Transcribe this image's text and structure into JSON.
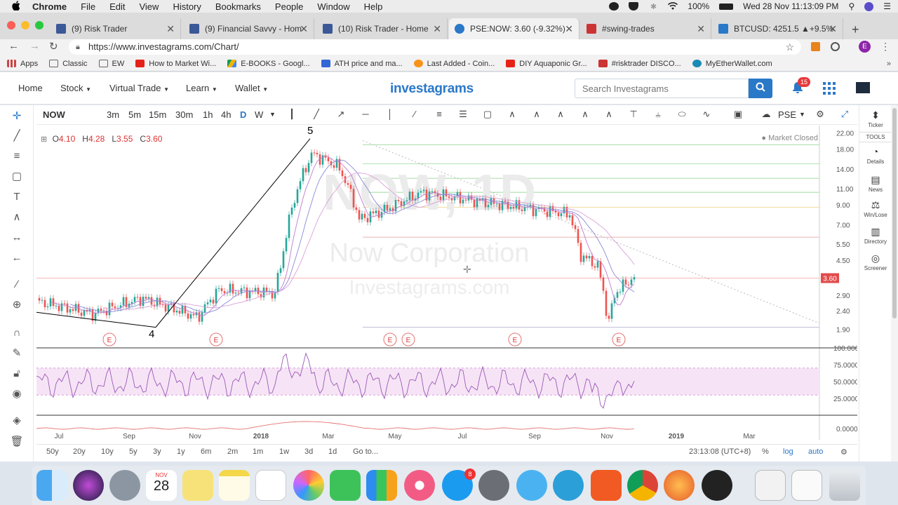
{
  "menubar": {
    "app": "Chrome",
    "items": [
      "File",
      "Edit",
      "View",
      "History",
      "Bookmarks",
      "People",
      "Window",
      "Help"
    ],
    "battery": "100%",
    "datetime": "Wed 28 Nov  11:13:09 PM"
  },
  "tabs": [
    {
      "title": "(9) Risk Trader",
      "color": "#3b5998"
    },
    {
      "title": "(9) Financial Savvy - Hom",
      "color": "#3b5998"
    },
    {
      "title": "(10) Risk Trader - Home",
      "color": "#3b5998"
    },
    {
      "title": "PSE:NOW: 3.60 (-9.32%)",
      "color": "#2a78c8"
    },
    {
      "title": "#swing-trades",
      "color": "#c33"
    },
    {
      "title": "BTCUSD: 4251.5 ▲+9.5%",
      "color": "#2a78c8"
    }
  ],
  "address": {
    "url": "https://www.investagrams.com/Chart/"
  },
  "bookmarks": [
    {
      "label": "Apps",
      "color": "#c44"
    },
    {
      "label": "Classic",
      "color": "#888"
    },
    {
      "label": "EW",
      "color": "#888"
    },
    {
      "label": "How to Market Wi...",
      "color": "#e62117"
    },
    {
      "label": "E-BOOKS - Googl...",
      "color": "#f4b400"
    },
    {
      "label": "ATH price and ma...",
      "color": "#3367d6"
    },
    {
      "label": "Last Added - Coin...",
      "color": "#f7931a"
    },
    {
      "label": "DIY Aquaponic Gr...",
      "color": "#e62117"
    },
    {
      "label": "#risktrader DISCO...",
      "color": "#c33"
    },
    {
      "label": "MyEtherWallet.com",
      "color": "#1b8ab5"
    }
  ],
  "sitenav": {
    "home": "Home",
    "stock": "Stock",
    "virtual_trade": "Virtual Trade",
    "learn": "Learn",
    "wallet": "Wallet",
    "logo": "investagrams",
    "search_placeholder": "Search Investagrams",
    "notif_count": "15"
  },
  "toolbar": {
    "symbol": "NOW",
    "intervals": [
      "3m",
      "5m",
      "15m",
      "30m",
      "1h",
      "4h",
      "D",
      "W"
    ],
    "selected_interval": "D",
    "exchange": "PSE"
  },
  "chart": {
    "open_label": "O",
    "open": "4.10",
    "high_label": "H",
    "high": "4.28",
    "low_label": "L",
    "low": "3.55",
    "close_label": "C",
    "close": "3.60",
    "status": "Market Closed",
    "watermark_line1": "NOW, 1D",
    "watermark_line2": "Now Corporation",
    "watermark_line3": "Investagrams.com",
    "wave_labels": [
      "5",
      "4"
    ],
    "price_axis": [
      "22.00",
      "18.00",
      "14.00",
      "11.00",
      "9.00",
      "7.00",
      "5.50",
      "4.50",
      "3.60",
      "2.90",
      "2.40",
      "1.90"
    ],
    "current_price": "3.60",
    "rsi_axis": [
      "100.0000",
      "75.0000",
      "50.0000",
      "25.0000"
    ],
    "macd_axis": [
      "0.0000"
    ],
    "time_axis": [
      "Jul",
      "Sep",
      "Nov",
      "2018",
      "Mar",
      "May",
      "Jul",
      "Sep",
      "Nov",
      "2019",
      "Mar"
    ],
    "earnings_marker": "E"
  },
  "right_panel": [
    "Ticker",
    "TOOLS",
    "Details",
    "News",
    "Win/Lose",
    "Directory",
    "Screener"
  ],
  "bottom": {
    "ranges": [
      "50y",
      "20y",
      "10y",
      "5y",
      "3y",
      "1y",
      "6m",
      "2m",
      "1m",
      "1w",
      "3d",
      "1d",
      "Go to..."
    ],
    "clock": "23:13:08 (UTC+8)",
    "percent": "%",
    "log": "log",
    "auto": "auto"
  },
  "dock": {
    "calendar_month": "NOV",
    "calendar_day": "28",
    "appstore_badge": "8"
  }
}
